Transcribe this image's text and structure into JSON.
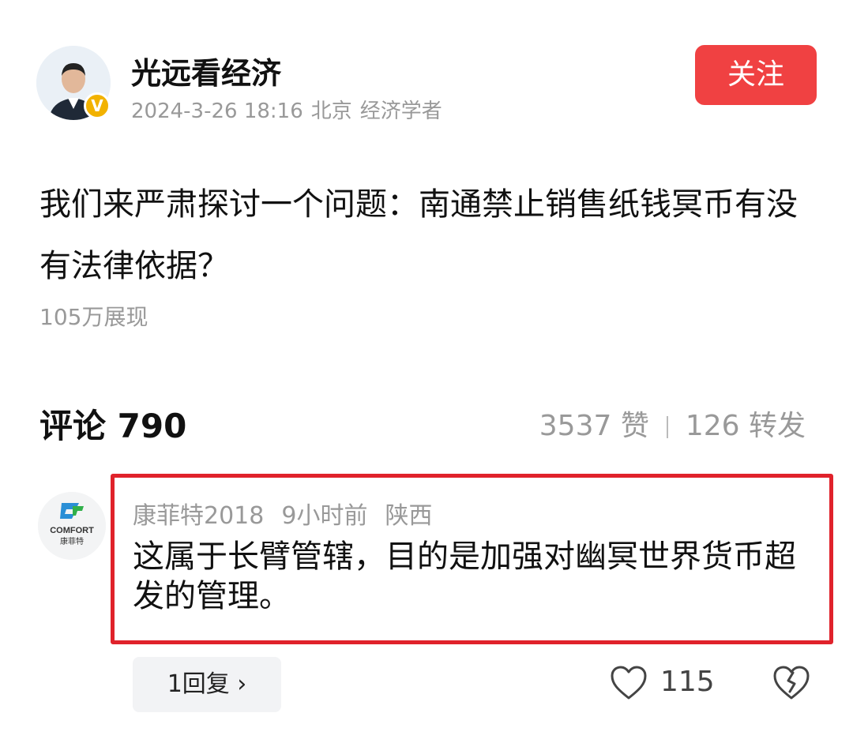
{
  "header": {
    "author": "光远看经济",
    "date": "2024-3-26 18:16",
    "location": "北京",
    "role": "经济学者",
    "verified_badge": "V",
    "follow_label": "关注",
    "accent_color": "#f04142"
  },
  "post": {
    "text": "我们来严肃探讨一个问题：南通禁止销售纸钱冥币有没有法律依据？",
    "views": "105万展现"
  },
  "comments_header": {
    "label": "评论",
    "count": "790",
    "likes": "3537 赞",
    "reposts": "126 转发"
  },
  "comment": {
    "avatar_logo": "COMFORT",
    "avatar_sub": "康菲特",
    "author": "康菲特2018",
    "time": "9小时前",
    "location": "陕西",
    "text": "这属于长臂管辖，目的是加强对幽冥世界货币超发的管理。",
    "reply_label": "1回复 ›",
    "like_count": "115",
    "highlight_color": "#e0222b"
  },
  "icons": {
    "like": "heart-outline-icon",
    "dislike": "broken-heart-icon",
    "verified": "verified-v-icon"
  }
}
